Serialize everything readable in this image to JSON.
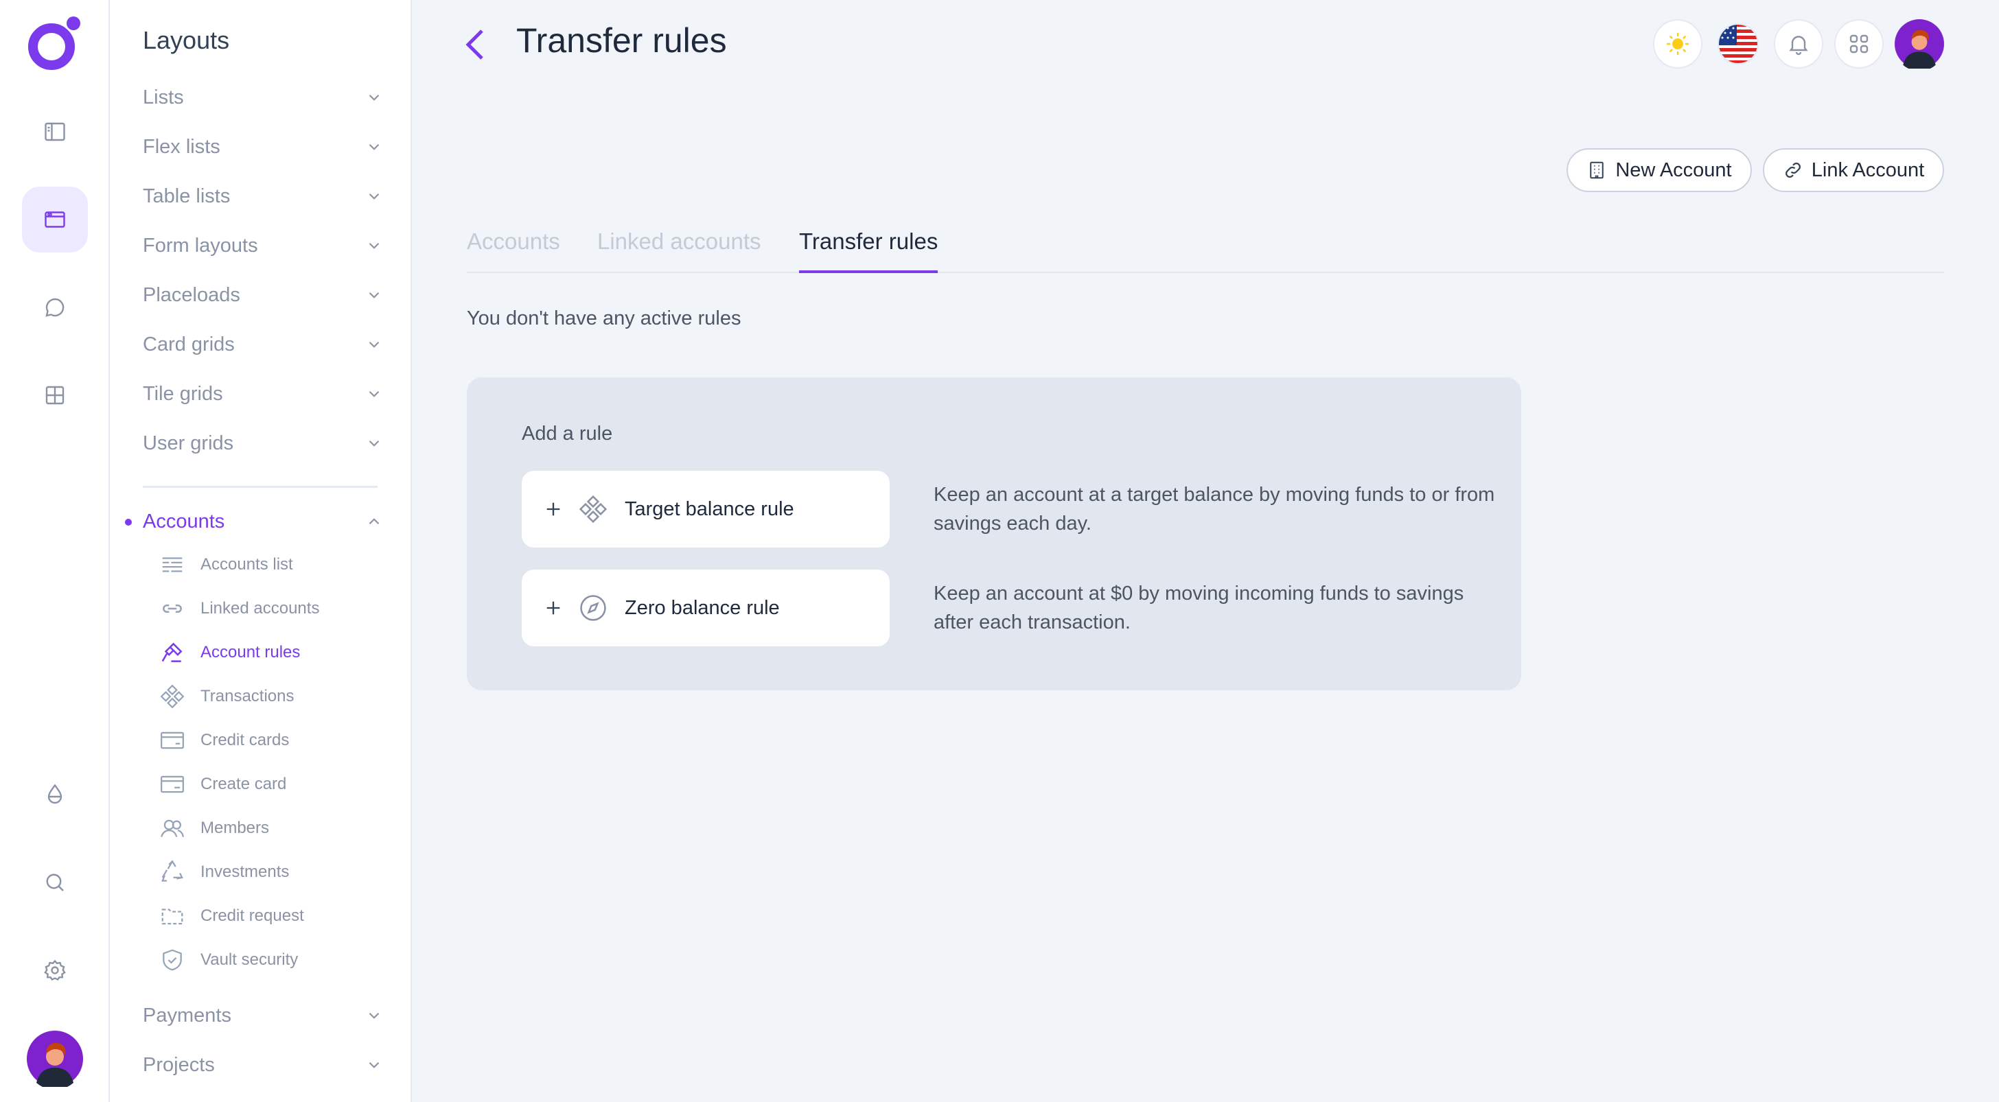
{
  "rail": {
    "items": [
      {
        "name": "sidebar-toggle-icon"
      },
      {
        "name": "layouts-icon",
        "active": true
      },
      {
        "name": "messages-icon"
      },
      {
        "name": "grid-icon"
      },
      {
        "name": "droplet-icon"
      },
      {
        "name": "search-icon"
      },
      {
        "name": "settings-icon"
      }
    ]
  },
  "submenu": {
    "title": "Layouts",
    "sections": [
      {
        "label": "Lists"
      },
      {
        "label": "Flex lists"
      },
      {
        "label": "Table lists"
      },
      {
        "label": "Form layouts"
      },
      {
        "label": "Placeloads"
      },
      {
        "label": "Card grids"
      },
      {
        "label": "Tile grids"
      },
      {
        "label": "User grids"
      }
    ],
    "accounts": {
      "label": "Accounts",
      "items": [
        {
          "label": "Accounts list",
          "icon": "list-icon"
        },
        {
          "label": "Linked accounts",
          "icon": "link-icon"
        },
        {
          "label": "Account rules",
          "icon": "gavel-icon",
          "active": true
        },
        {
          "label": "Transactions",
          "icon": "diamond-grid-icon"
        },
        {
          "label": "Credit cards",
          "icon": "credit-card-icon"
        },
        {
          "label": "Create card",
          "icon": "card-add-icon"
        },
        {
          "label": "Members",
          "icon": "users-icon"
        },
        {
          "label": "Investments",
          "icon": "recycle-icon"
        },
        {
          "label": "Credit request",
          "icon": "folder-icon"
        },
        {
          "label": "Vault security",
          "icon": "shield-icon"
        }
      ]
    },
    "after": [
      {
        "label": "Payments"
      },
      {
        "label": "Projects"
      }
    ]
  },
  "header": {
    "title": "Transfer rules",
    "colors": {
      "accent": "#7c3aed",
      "sun": "#facc15"
    }
  },
  "actions": {
    "new_account": "New Account",
    "link_account": "Link Account"
  },
  "tabs": [
    {
      "label": "Accounts"
    },
    {
      "label": "Linked accounts"
    },
    {
      "label": "Transfer rules",
      "active": true
    }
  ],
  "empty_text": "You don't have any active rules",
  "rules": {
    "title": "Add a rule",
    "items": [
      {
        "label": "Target balance rule",
        "description": "Keep an account at a target balance by moving funds to or from savings each day."
      },
      {
        "label": "Zero balance rule",
        "description": "Keep an account at $0 by moving incoming funds to savings after each transaction."
      }
    ]
  }
}
